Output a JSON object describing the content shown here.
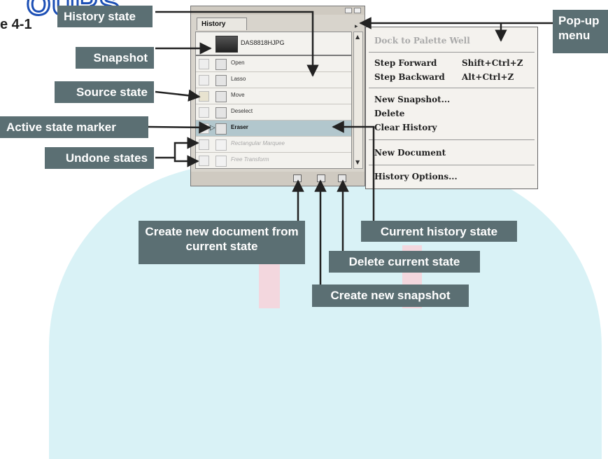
{
  "figure": {
    "watermark": "OURS",
    "label": "e 4-1"
  },
  "palette": {
    "tab_label": "History",
    "snapshot_name": "DAS8818HJPG",
    "states": [
      {
        "label": "Open",
        "status": "normal"
      },
      {
        "label": "Lasso",
        "status": "normal"
      },
      {
        "label": "Move",
        "status": "normal"
      },
      {
        "label": "Deselect",
        "status": "normal"
      },
      {
        "label": "Eraser",
        "status": "active"
      },
      {
        "label": "Rectangular Marquee",
        "status": "undone"
      },
      {
        "label": "Free Transform",
        "status": "undone"
      }
    ]
  },
  "menu": {
    "items": [
      {
        "label": "Dock to Palette Well",
        "shortcut": "",
        "enabled": false
      },
      {
        "label": "Step Forward",
        "shortcut": "Shift+Ctrl+Z",
        "enabled": true
      },
      {
        "label": "Step Backward",
        "shortcut": "Alt+Ctrl+Z",
        "enabled": true
      },
      {
        "label": "New Snapshot...",
        "shortcut": "",
        "enabled": true
      },
      {
        "label": "Delete",
        "shortcut": "",
        "enabled": true
      },
      {
        "label": "Clear History",
        "shortcut": "",
        "enabled": true
      },
      {
        "label": "New Document",
        "shortcut": "",
        "enabled": true
      },
      {
        "label": "History Options...",
        "shortcut": "",
        "enabled": true
      }
    ]
  },
  "callouts": {
    "history_state": "History state",
    "snapshot": "Snapshot",
    "source_state": "Source state",
    "active_state_marker": "Active state marker",
    "undone_states": "Undone states",
    "popup_menu_line1": "Pop-up",
    "popup_menu_line2": "menu",
    "create_new_document": "Create new document from current state",
    "current_history_state": "Current history state",
    "delete_current_state": "Delete current state",
    "create_new_snapshot": "Create new snapshot"
  },
  "colors": {
    "callout_bg": "#5b6f73",
    "active_row": "#b2c7cd",
    "arc": "#d9f2f6"
  }
}
